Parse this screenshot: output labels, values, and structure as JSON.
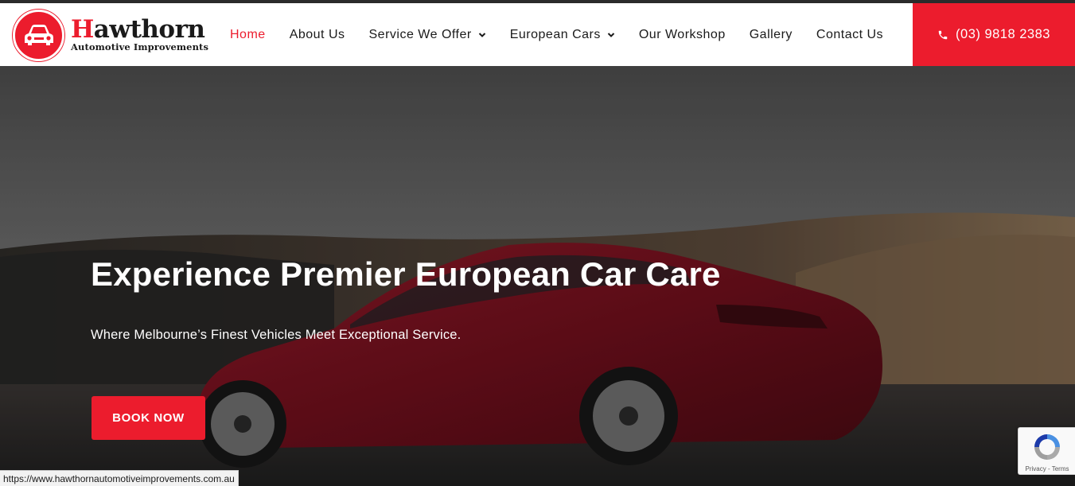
{
  "brand": {
    "title_first_letter": "H",
    "title_rest": "awthorn",
    "subtitle": "Automotive Improvements",
    "accent_color": "#ec1c2d",
    "logo_icon": "car-icon"
  },
  "nav": {
    "items": [
      {
        "label": "Home",
        "active": true,
        "has_dropdown": false
      },
      {
        "label": "About Us",
        "active": false,
        "has_dropdown": false
      },
      {
        "label": "Service We Offer",
        "active": false,
        "has_dropdown": true
      },
      {
        "label": "European Cars",
        "active": false,
        "has_dropdown": true
      },
      {
        "label": "Our Workshop",
        "active": false,
        "has_dropdown": false
      },
      {
        "label": "Gallery",
        "active": false,
        "has_dropdown": false
      },
      {
        "label": "Contact Us",
        "active": false,
        "has_dropdown": false
      }
    ],
    "phone": "(03) 9818 2383",
    "phone_icon": "phone-icon"
  },
  "hero": {
    "title": "Experience Premier European Car Care",
    "subtitle": "Where Melbourne’s Finest Vehicles Meet Exceptional Service.",
    "cta_label": "BOOK NOW"
  },
  "recaptcha": {
    "links": "Privacy - Terms"
  },
  "status_bar": {
    "url": "https://www.hawthornautomotiveimprovements.com.au"
  }
}
